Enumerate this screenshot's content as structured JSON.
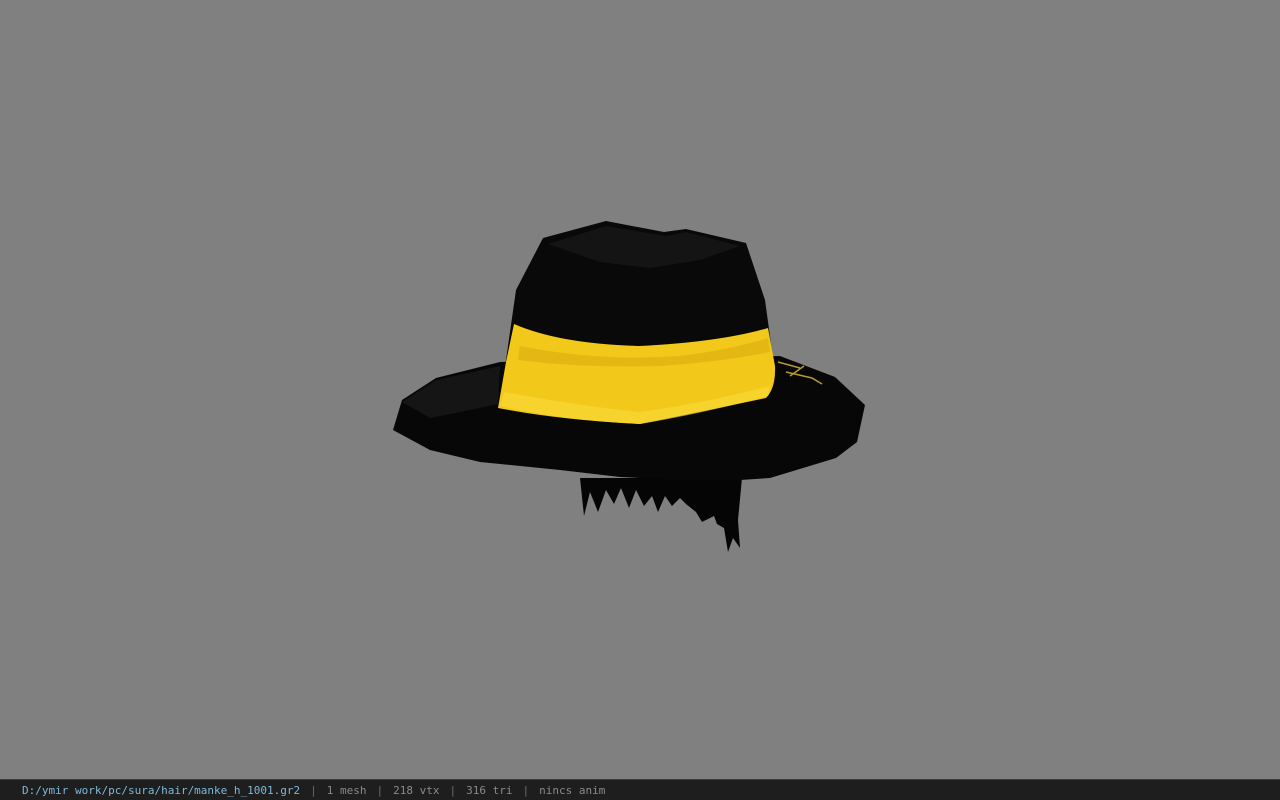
{
  "viewport": {
    "background_color": "#808080",
    "model": {
      "name": "hat-model",
      "colors": {
        "hat": "#060606",
        "band": "#f2c81a",
        "band_shade": "#d8a90c",
        "hair": "#050505"
      }
    }
  },
  "statusbar": {
    "file_path": "D:/ymir work/pc/sura/hair/manke_h_1001.gr2",
    "separator": "|",
    "mesh_count": "1 mesh",
    "vertex_count": "218 vtx",
    "triangle_count": "316 tri",
    "anim_status": "nincs anim",
    "colors": {
      "path": "#7fb8d8",
      "text": "#8a8a8a",
      "background": "#1e1e1e"
    }
  }
}
